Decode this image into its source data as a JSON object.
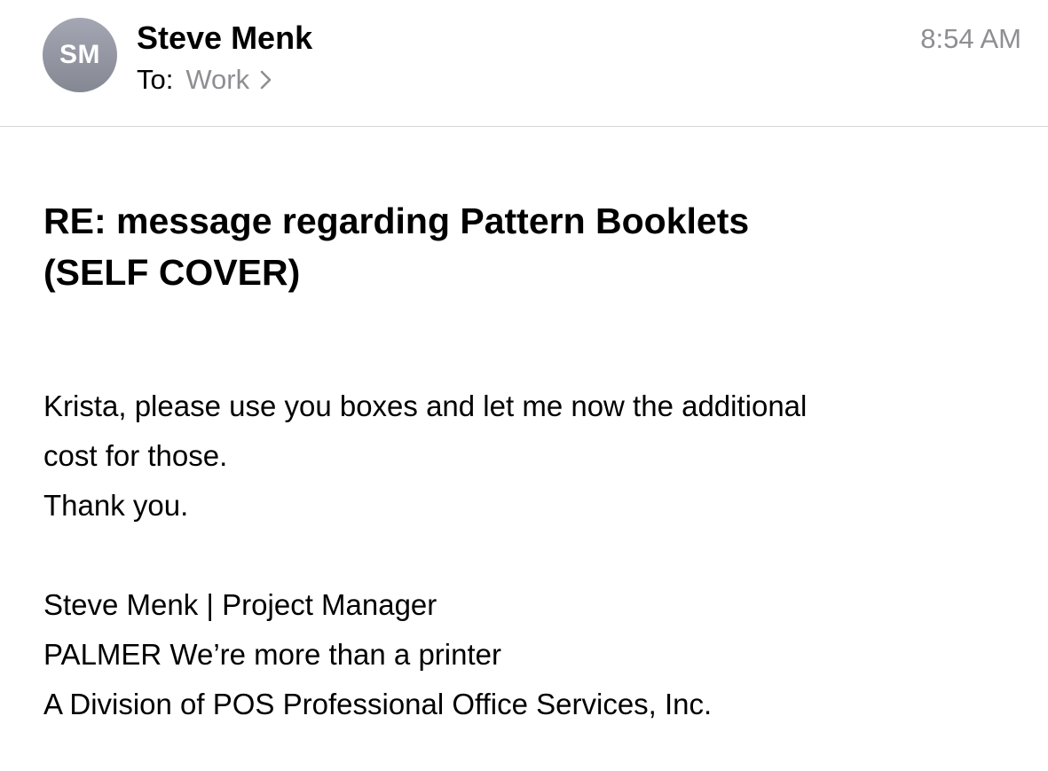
{
  "header": {
    "avatar_initials": "SM",
    "sender_name": "Steve Menk",
    "to_label": "To:",
    "recipient": "Work",
    "timestamp": "8:54 AM"
  },
  "message": {
    "subject_line_1": "RE: message regarding Pattern Booklets",
    "subject_line_2": "(SELF COVER)",
    "body_line_1": "Krista, please use you boxes and let me now the additional",
    "body_line_2": "cost for those.",
    "body_line_3": "Thank you.",
    "signature_line_1": "Steve Menk | Project Manager",
    "signature_line_2": "PALMER We’re more than a printer",
    "signature_line_3": "A Division of POS Professional Office Services, Inc."
  },
  "icons": {
    "recipient_chevron": "chevron-right-icon"
  },
  "colors": {
    "avatar": "#969aa5",
    "secondary_text": "#8e8e93",
    "divider": "#d6d6d9"
  }
}
